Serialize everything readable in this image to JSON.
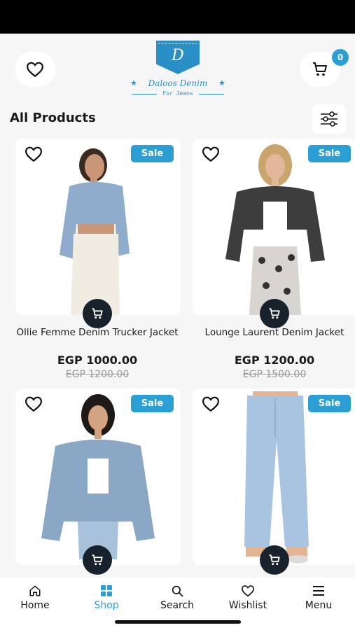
{
  "header": {
    "logo_initial": "D",
    "logo_name": "Daloos Denim",
    "logo_tagline": "For Jeans",
    "cart_count": "0"
  },
  "section": {
    "title": "All Products"
  },
  "products": [
    {
      "name": "Ollie Femme Denim Trucker Jacket",
      "price": "EGP 1000.00",
      "old_price": "EGP 1200.00",
      "badge": "Sale"
    },
    {
      "name": "Lounge Laurent Denim Jacket",
      "price": "EGP 1200.00",
      "old_price": "EGP 1500.00",
      "badge": "Sale"
    },
    {
      "badge": "Sale"
    },
    {
      "badge": "Sale"
    }
  ],
  "nav": [
    {
      "label": "Home",
      "icon": "home-icon"
    },
    {
      "label": "Shop",
      "icon": "grid-icon",
      "active": true
    },
    {
      "label": "Search",
      "icon": "search-icon"
    },
    {
      "label": "Wishlist",
      "icon": "heart-icon"
    },
    {
      "label": "Menu",
      "icon": "menu-icon"
    }
  ],
  "colors": {
    "accent": "#2b9fd3",
    "fab": "#17222c",
    "background": "#f6f6f6"
  }
}
